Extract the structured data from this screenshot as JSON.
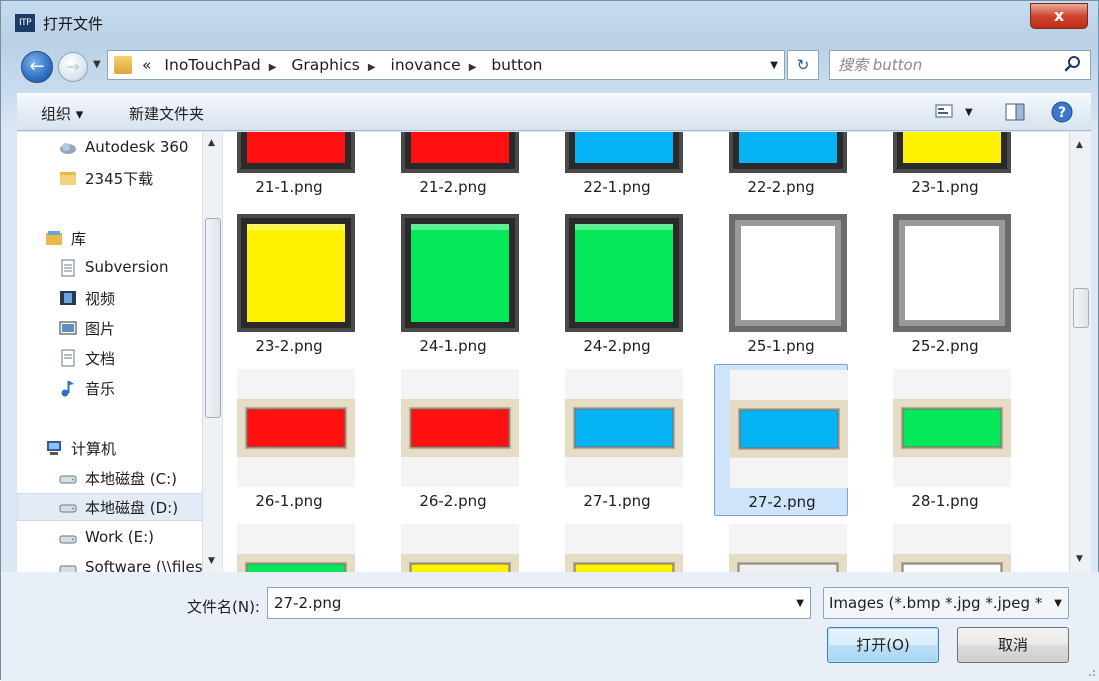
{
  "window": {
    "app_icon_text": "ITP",
    "title": "打开文件",
    "close_label": "x"
  },
  "address": {
    "overflow": "«",
    "crumbs": [
      "InoTouchPad",
      "Graphics",
      "inovance",
      "button"
    ]
  },
  "search": {
    "placeholder": "搜索 button"
  },
  "toolbar": {
    "organize": "组织 ▾",
    "new_folder": "新建文件夹"
  },
  "nav": {
    "items": [
      {
        "label": "Autodesk 360",
        "icon": "cloud-icon"
      },
      {
        "label": "2345下载",
        "icon": "folder-icon"
      },
      {
        "label": "库",
        "icon": "library-icon"
      },
      {
        "label": "Subversion",
        "icon": "document-icon"
      },
      {
        "label": "视频",
        "icon": "video-icon"
      },
      {
        "label": "图片",
        "icon": "picture-icon"
      },
      {
        "label": "文档",
        "icon": "document-icon"
      },
      {
        "label": "音乐",
        "icon": "music-icon"
      },
      {
        "label": "计算机",
        "icon": "computer-icon"
      },
      {
        "label": "本地磁盘 (C:)",
        "icon": "drive-icon"
      },
      {
        "label": "本地磁盘 (D:)",
        "icon": "drive-icon",
        "selected": true
      },
      {
        "label": "Work (E:)",
        "icon": "drive-icon"
      },
      {
        "label": "Software (\\\\files",
        "icon": "network-drive-icon"
      }
    ]
  },
  "files": [
    {
      "name": "21-1.png",
      "style": "red-dark-frame"
    },
    {
      "name": "21-2.png",
      "style": "red-dark-frame"
    },
    {
      "name": "22-1.png",
      "style": "blue-dark-frame"
    },
    {
      "name": "22-2.png",
      "style": "blue-dark-frame"
    },
    {
      "name": "23-1.png",
      "style": "yellow-dark-frame"
    },
    {
      "name": "23-2.png",
      "style": "yellow-dark-frame"
    },
    {
      "name": "24-1.png",
      "style": "green-dark-frame"
    },
    {
      "name": "24-2.png",
      "style": "green-dark-frame"
    },
    {
      "name": "25-1.png",
      "style": "white-gray-frame"
    },
    {
      "name": "25-2.png",
      "style": "white-gray-frame"
    },
    {
      "name": "26-1.png",
      "style": "red-beige"
    },
    {
      "name": "26-2.png",
      "style": "red-beige"
    },
    {
      "name": "27-1.png",
      "style": "blue-beige"
    },
    {
      "name": "27-2.png",
      "style": "blue-beige",
      "selected": true
    },
    {
      "name": "28-1.png",
      "style": "green-beige"
    },
    {
      "name": "",
      "style": "green-beige"
    },
    {
      "name": "",
      "style": "yellow-beige"
    },
    {
      "name": "",
      "style": "yellow-beige"
    },
    {
      "name": "",
      "style": "gray-beige"
    },
    {
      "name": "",
      "style": "white-beige"
    }
  ],
  "bottom": {
    "filename_label": "文件名(N):",
    "filename_value": "27-2.png",
    "filetype": "Images (*.bmp *.jpg *.jpeg *",
    "open_label": "打开(O)",
    "cancel_label": "取消"
  },
  "colors": {
    "red": "#ff0f0f",
    "blue": "#06b3f5",
    "yellow": "#fff200",
    "green": "#05e85a",
    "white": "#ffffff",
    "gray": "#f1f1f1",
    "selection": "#cde4fb"
  }
}
